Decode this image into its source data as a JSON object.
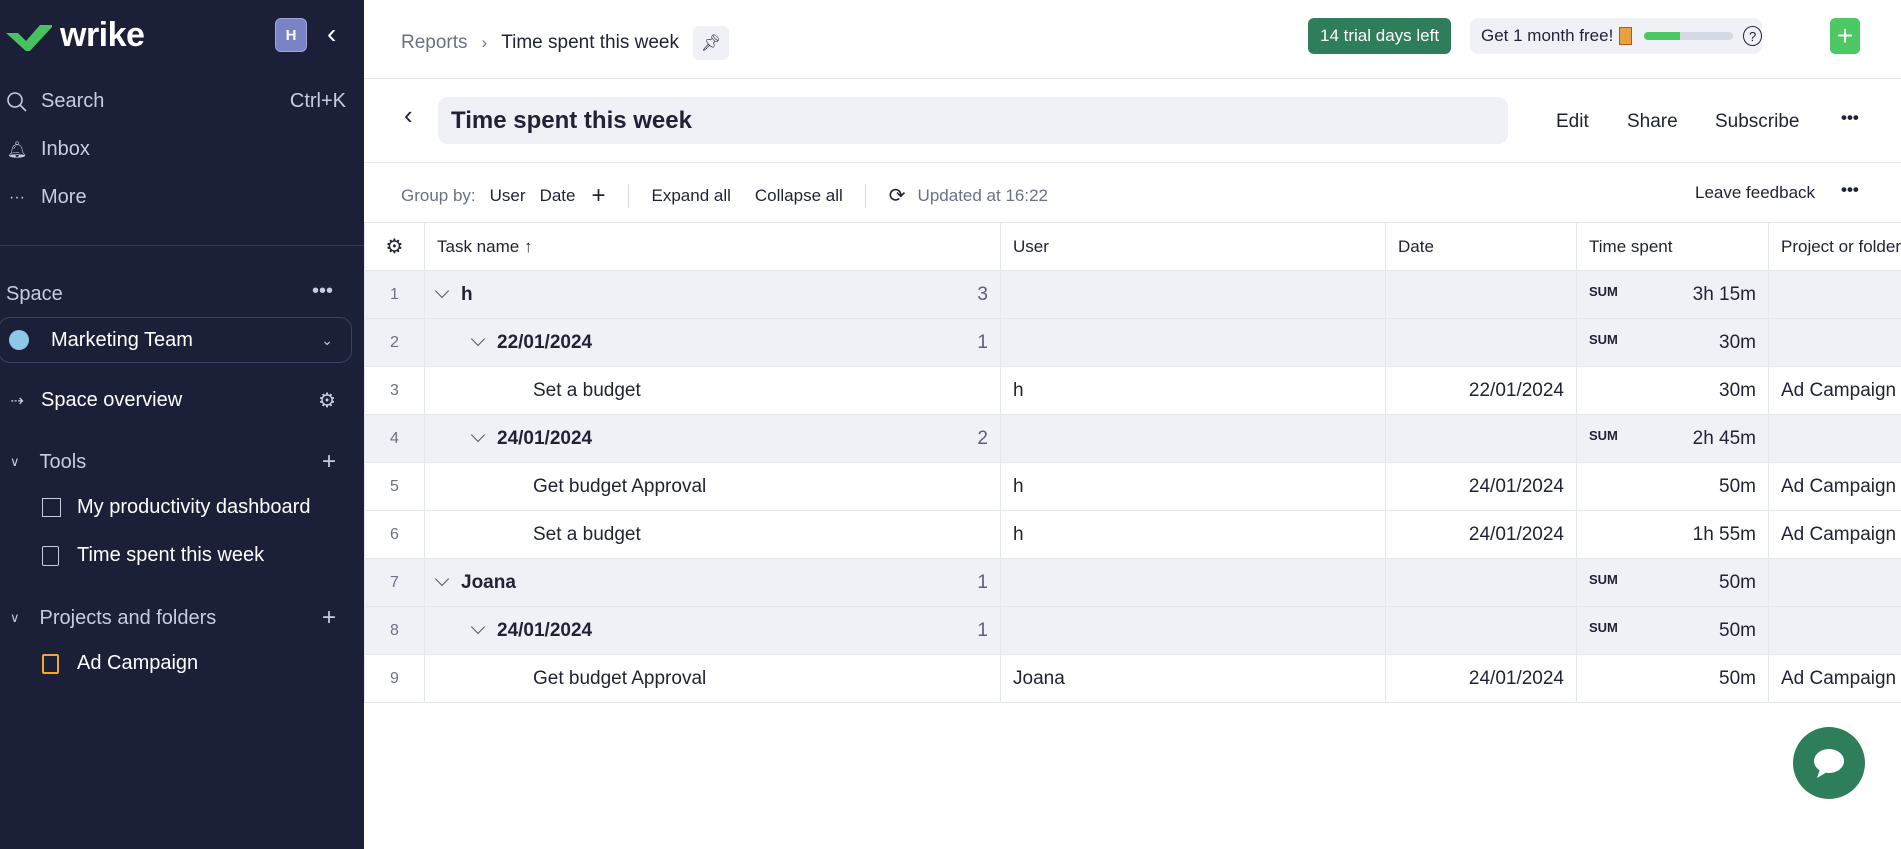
{
  "sidebar": {
    "logo": "wrike",
    "avatar": "H",
    "search": "Search",
    "search_shortcut": "Ctrl+K",
    "inbox": "Inbox",
    "more": "More",
    "space_label": "Space",
    "space_name": "Marketing Team",
    "space_overview": "Space overview",
    "tools": "Tools",
    "tool_items": [
      "My productivity dashboard",
      "Time spent this week"
    ],
    "projects": "Projects and folders",
    "project_items": [
      "Ad Campaign"
    ]
  },
  "header": {
    "breadcrumb": [
      "Reports",
      "Time spent this week"
    ],
    "trial": "14 trial days left",
    "promo": "Get 1 month free!",
    "promo_progress": 0.4,
    "colors": {
      "trial": "#2e7d5b",
      "accent": "#4cc864",
      "sidebar": "#1b1f38"
    }
  },
  "report": {
    "title": "Time spent this week",
    "edit": "Edit",
    "share": "Share",
    "subscribe": "Subscribe"
  },
  "toolbar": {
    "group_by": "Group by:",
    "groups": [
      "User",
      "Date"
    ],
    "expand": "Expand all",
    "collapse": "Collapse all",
    "updated": "Updated at 16:22",
    "feedback": "Leave feedback"
  },
  "table": {
    "columns": [
      "Task name",
      "User",
      "Date",
      "Time spent",
      "Project or folder"
    ],
    "sum_label": "SUM",
    "rows": [
      {
        "n": "1",
        "level": 0,
        "group": true,
        "name": "h",
        "count": "3",
        "time": "3h 15m"
      },
      {
        "n": "2",
        "level": 1,
        "group": true,
        "name": "22/01/2024",
        "count": "1",
        "time": "30m"
      },
      {
        "n": "3",
        "level": 2,
        "group": false,
        "name": "Set a budget",
        "user": "h",
        "date": "22/01/2024",
        "time": "30m",
        "project": "Ad Campaign"
      },
      {
        "n": "4",
        "level": 1,
        "group": true,
        "name": "24/01/2024",
        "count": "2",
        "time": "2h 45m"
      },
      {
        "n": "5",
        "level": 2,
        "group": false,
        "name": "Get budget Approval",
        "user": "h",
        "date": "24/01/2024",
        "time": "50m",
        "project": "Ad Campaign"
      },
      {
        "n": "6",
        "level": 2,
        "group": false,
        "name": "Set a budget",
        "user": "h",
        "date": "24/01/2024",
        "time": "1h 55m",
        "project": "Ad Campaign"
      },
      {
        "n": "7",
        "level": 0,
        "group": true,
        "name": "Joana",
        "count": "1",
        "time": "50m"
      },
      {
        "n": "8",
        "level": 1,
        "group": true,
        "name": "24/01/2024",
        "count": "1",
        "time": "50m"
      },
      {
        "n": "9",
        "level": 2,
        "group": false,
        "name": "Get budget Approval",
        "user": "Joana",
        "date": "24/01/2024",
        "time": "50m",
        "project": "Ad Campaign"
      }
    ]
  }
}
